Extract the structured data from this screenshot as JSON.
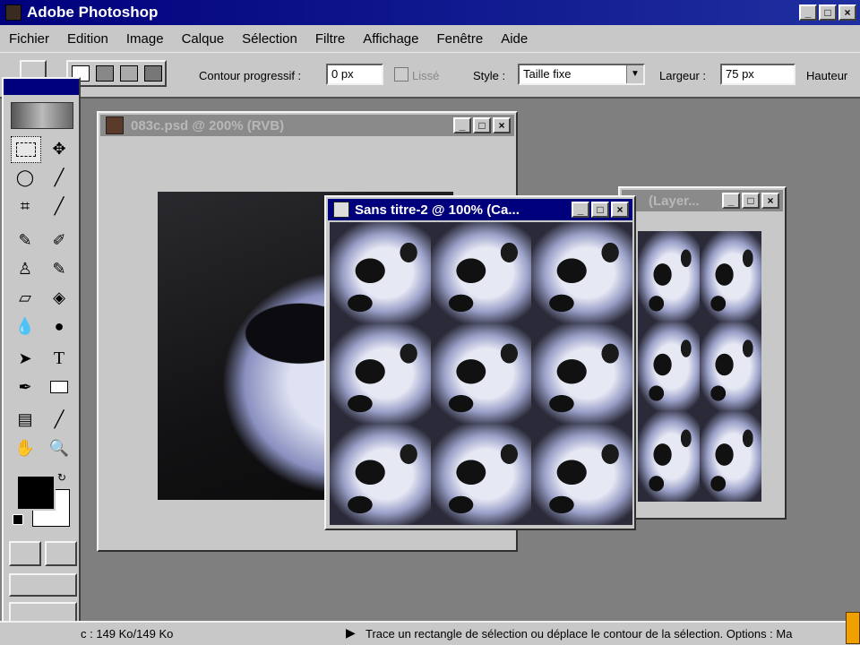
{
  "app": {
    "title": "Adobe Photoshop",
    "window_buttons": [
      "_",
      "□",
      "×"
    ]
  },
  "menu": [
    "Fichier",
    "Edition",
    "Image",
    "Calque",
    "Sélection",
    "Filtre",
    "Affichage",
    "Fenêtre",
    "Aide"
  ],
  "options": {
    "feather_label": "Contour progressif :",
    "feather_value": "0 px",
    "antialias_label": "Lissé",
    "style_label": "Style :",
    "style_value": "Taille fixe",
    "width_label": "Largeur :",
    "width_value": "75 px",
    "height_label": "Hauteur"
  },
  "documents": {
    "doc1": {
      "title": "083c.psd @ 200% (RVB)"
    },
    "doc2": {
      "title": "Sans titre-2 @ 100% (Ca..."
    },
    "doc3": {
      "title": "(Layer..."
    }
  },
  "tools": [
    "rectangular-marquee",
    "move",
    "lasso",
    "magic-wand",
    "crop",
    "eyedropper",
    "airbrush",
    "paintbrush",
    "rubber-stamp",
    "history-brush",
    "eraser",
    "paint-bucket",
    "blur",
    "dodge",
    "path-selection",
    "type",
    "pen",
    "rectangle",
    "notes",
    "color-sampler",
    "hand",
    "zoom"
  ],
  "status": {
    "doc_size": "c : 149 Ko/149 Ko",
    "hint": "Trace un rectangle de sélection ou déplace le contour de la sélection. Options : Ma"
  },
  "colors": {
    "titlebar": "#00007c",
    "chrome": "#c8c8c8",
    "workspace": "#7f7f7f"
  }
}
